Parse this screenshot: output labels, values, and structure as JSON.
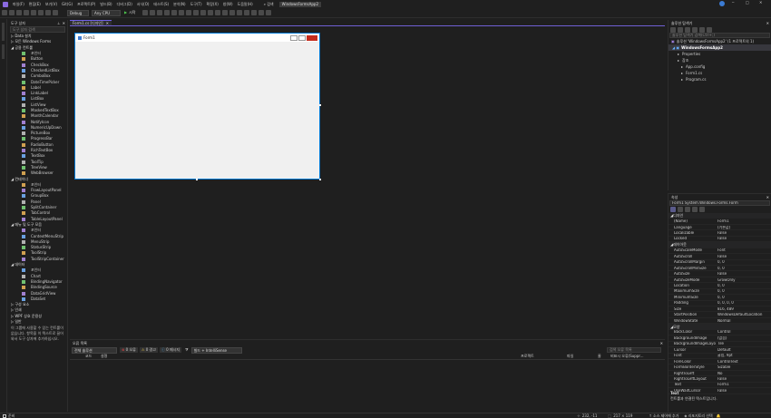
{
  "menu": {
    "items": [
      "파일(F)",
      "편집(E)",
      "보기(V)",
      "Git(G)",
      "프로젝트(P)",
      "빌드(B)",
      "디버그(D)",
      "서식(O)",
      "테스트(S)",
      "분석(N)",
      "도구(T)",
      "확장(X)",
      "창(W)",
      "도움말(H)"
    ],
    "search_label": "검색",
    "solution_name": "WindowsFormsApp2"
  },
  "toolbar": {
    "config": "Debug",
    "platform": "Any CPU",
    "start_label": "시작"
  },
  "toolbox": {
    "title": "도구 상자",
    "search_placeholder": "도구 상자 검색",
    "categories": [
      {
        "label": "▷ Data 설치"
      },
      {
        "label": "▷ 모든 Windows Forms"
      },
      {
        "label": "◢ 공용 컨트롤",
        "items": [
          "포인터",
          "Button",
          "CheckBox",
          "CheckedListBox",
          "ComboBox",
          "DateTimePicker",
          "Label",
          "LinkLabel",
          "ListBox",
          "ListView",
          "MaskedTextBox",
          "MonthCalendar",
          "NotifyIcon",
          "NumericUpDown",
          "PictureBox",
          "ProgressBar",
          "RadioButton",
          "RichTextBox",
          "TextBox",
          "ToolTip",
          "TreeView",
          "WebBrowser"
        ]
      },
      {
        "label": "◢ 컨테이너",
        "items": [
          "포인터",
          "FlowLayoutPanel",
          "GroupBox",
          "Panel",
          "SplitContainer",
          "TabControl",
          "TableLayoutPanel"
        ]
      },
      {
        "label": "◢ 메뉴 및 도구 모음",
        "items": [
          "포인터",
          "ContextMenuStrip",
          "MenuStrip",
          "StatusStrip",
          "ToolStrip",
          "ToolStripContainer"
        ]
      },
      {
        "label": "◢ 데이터",
        "items": [
          "포인터",
          "Chart",
          "BindingNavigator",
          "BindingSource",
          "DataGridView",
          "DataSet"
        ]
      },
      {
        "label": "▷ 구성 요소"
      },
      {
        "label": "▷ 인쇄"
      },
      {
        "label": "▷ WPF 상호 운용성"
      },
      {
        "label": "▷ 일반"
      }
    ],
    "note": "이 그룹에 사용할 수 있는 컨트롤이 없습니다. 항목을 이 텍스트로 끌어와서 도구 상자에 추가하십시오."
  },
  "designer": {
    "tab_label": "Form1.cs [디자인]",
    "form_title": "Form1"
  },
  "errors": {
    "title": "오류 목록",
    "scope": "전체 솔루션",
    "errors_label": "0 오류",
    "warnings_label": "0 경고",
    "messages_label": "0 메시지",
    "build_filter": "빌드 + IntelliSense",
    "search_placeholder": "검색 오류 목록",
    "columns": [
      "코드",
      "설명",
      "프로젝트",
      "파일",
      "줄",
      "비표시 오류(Suppr..."
    ]
  },
  "solution": {
    "title": "솔루션 탐색기",
    "search_placeholder": "솔루션 탐색기 검색(Ctrl+;)",
    "root": "솔루션 'WindowsFormsApp2' (1 프로젝트의 1)",
    "project": "WindowsFormsApp2",
    "nodes": [
      "Properties",
      "참조",
      "App.config",
      "Form1.cs",
      "Program.cs"
    ]
  },
  "properties": {
    "title": "속성",
    "object": "Form1  System.Windows.Forms.Form",
    "categories": [
      {
        "label": "디자인",
        "rows": [
          [
            "(Name)",
            "Form1"
          ],
          [
            "Language",
            "(기본값)"
          ],
          [
            "Localizable",
            "False"
          ],
          [
            "Locked",
            "False"
          ]
        ]
      },
      {
        "label": "레이아웃",
        "rows": [
          [
            "AutoScaleMode",
            "Font"
          ],
          [
            "AutoScroll",
            "False"
          ],
          [
            "AutoScrollMargin",
            "0, 0"
          ],
          [
            "AutoScrollMinSize",
            "0, 0"
          ],
          [
            "AutoSize",
            "False"
          ],
          [
            "AutoSizeMode",
            "GrowOnly"
          ],
          [
            "Location",
            "0, 0"
          ],
          [
            "MaximumSize",
            "0, 0"
          ],
          [
            "MinimumSize",
            "0, 0"
          ],
          [
            "Padding",
            "0, 0, 0, 0"
          ],
          [
            "Size",
            "816, 489"
          ],
          [
            "StartPosition",
            "WindowsDefaultLocation"
          ],
          [
            "WindowState",
            "Normal"
          ]
        ]
      },
      {
        "label": "모양",
        "rows": [
          [
            "BackColor",
            "Control"
          ],
          [
            "BackgroundImage",
            "(없음)"
          ],
          [
            "BackgroundImageLayout",
            "Tile"
          ],
          [
            "Cursor",
            "Default"
          ],
          [
            "Font",
            "굴림, 9pt"
          ],
          [
            "ForeColor",
            "ControlText"
          ],
          [
            "FormBorderStyle",
            "Sizable"
          ],
          [
            "RightToLeft",
            "No"
          ],
          [
            "RightToLeftLayout",
            "False"
          ],
          [
            "Text",
            "Form1"
          ],
          [
            "UseWaitCursor",
            "False"
          ]
        ]
      }
    ],
    "desc_title": "Text",
    "desc_text": "컨트롤과 연결된 텍스트입니다."
  },
  "status": {
    "ready": "준비",
    "position": "232, -11",
    "size": "217 × 119",
    "source_control": "소스 제어에 추가",
    "repo": "리포지토리 선택"
  },
  "colors": {
    "accent": "#7160e8",
    "form_bg": "#f0f0f0",
    "selection": "#0078d4"
  }
}
